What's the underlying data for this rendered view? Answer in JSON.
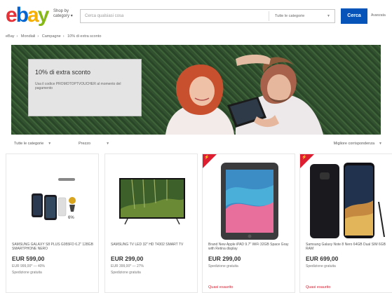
{
  "header": {
    "logo": [
      "e",
      "b",
      "a",
      "y"
    ],
    "shop_by_category": "Shop by category",
    "search_placeholder": "Cerca qualsiasi cosa",
    "category_select": "Tutte le categorie",
    "search_button": "Cerca",
    "advanced": "Avanzata"
  },
  "breadcrumb": [
    "eBay",
    "Mondiali",
    "Campagne",
    "10% di extra sconto"
  ],
  "hero": {
    "title": "10% di extra sconto",
    "subtitle": "Usa il codice PROMOTOPTVOUCHER al momento del pagamento"
  },
  "filters": {
    "category": "Tutte le categorie",
    "price": "Prezzo",
    "sort": "Migliore corrispondenza"
  },
  "products": [
    {
      "title": "SAMSUNG GALAXY S8 PLUS G955FD 6.2\" 128GB SMARTPHONE NERO",
      "price": "EUR 599,00",
      "was": "EUR 999,00* — 40%",
      "shipping": "Spedizione gratuita",
      "urgency": "",
      "badge": false
    },
    {
      "title": "SAMSUNG TV LED 32\" HD T4302 SMART TV",
      "price": "EUR 299,00",
      "was": "EUR 399,00* — 27%",
      "shipping": "Spedizione gratuita",
      "urgency": "",
      "badge": false
    },
    {
      "title": "Brand New Apple iPAD 9.7\" WiFi 32GB Space Gray with Retina display",
      "price": "EUR 299,00",
      "was": "",
      "shipping": "Spedizione gratuita",
      "urgency": "Quasi esaurito",
      "badge": true
    },
    {
      "title": "Samsung Galaxy Note 8 Nero 64GB Dual SIM 6GB RAM",
      "price": "EUR 699,00",
      "was": "",
      "shipping": "Spedizione gratuita",
      "urgency": "Quasi esaurito",
      "badge": true
    }
  ],
  "colors": {
    "ebay_red": "#e53238",
    "ebay_blue": "#0064d2",
    "ebay_yellow": "#f5af02",
    "ebay_green": "#86b817",
    "button_blue": "#0654ba",
    "urgent_red": "#dd1e31"
  }
}
